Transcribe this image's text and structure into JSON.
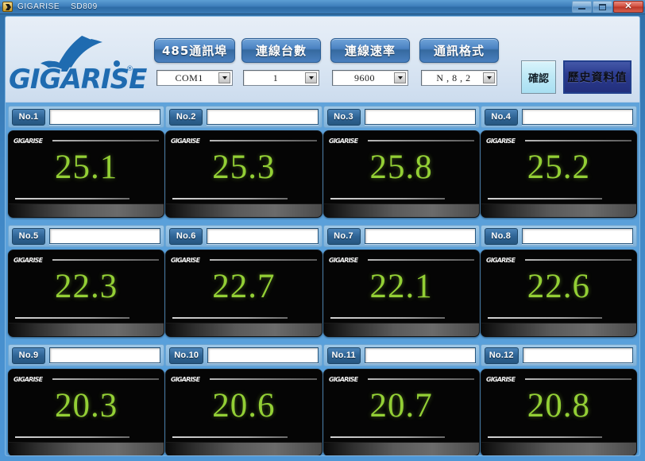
{
  "window": {
    "app_icon": "app-icon",
    "title_brand": "GIGARISE",
    "title_model": "SD809",
    "minimize_label": "",
    "maximize_label": "",
    "close_label": "✕"
  },
  "header": {
    "logo_text": "GIGARISE",
    "logo_tm": "®",
    "controls": [
      {
        "key": "port",
        "button_label": "485通訊埠",
        "value": "COM1"
      },
      {
        "key": "count",
        "button_label": "連線台數",
        "value": "1"
      },
      {
        "key": "baud",
        "button_label": "連線速率",
        "value": "9600"
      },
      {
        "key": "format",
        "button_label": "通訊格式",
        "value": "N , 8 , 2"
      }
    ],
    "confirm_label": "確認",
    "history_label": "歷史資料值"
  },
  "colors": {
    "accent_blue": "#3e7fbb",
    "panel_background": "#050505",
    "value_green": "#93cf35",
    "grid_background": "#5aa0da",
    "header_background": "#dde8f4",
    "history_button": "#2b3b8f",
    "confirm_button": "#bfe9f6"
  },
  "channels": [
    {
      "tag": "No.1",
      "name": "",
      "value": "25.1",
      "panel_logo": "GIGARISE"
    },
    {
      "tag": "No.2",
      "name": "",
      "value": "25.3",
      "panel_logo": "GIGARISE"
    },
    {
      "tag": "No.3",
      "name": "",
      "value": "25.8",
      "panel_logo": "GIGARISE"
    },
    {
      "tag": "No.4",
      "name": "",
      "value": "25.2",
      "panel_logo": "GIGARISE"
    },
    {
      "tag": "No.5",
      "name": "",
      "value": "22.3",
      "panel_logo": "GIGARISE"
    },
    {
      "tag": "No.6",
      "name": "",
      "value": "22.7",
      "panel_logo": "GIGARISE"
    },
    {
      "tag": "No.7",
      "name": "",
      "value": "22.1",
      "panel_logo": "GIGARISE"
    },
    {
      "tag": "No.8",
      "name": "",
      "value": "22.6",
      "panel_logo": "GIGARISE"
    },
    {
      "tag": "No.9",
      "name": "",
      "value": "20.3",
      "panel_logo": "GIGARISE"
    },
    {
      "tag": "No.10",
      "name": "",
      "value": "20.6",
      "panel_logo": "GIGARISE"
    },
    {
      "tag": "No.11",
      "name": "",
      "value": "20.7",
      "panel_logo": "GIGARISE"
    },
    {
      "tag": "No.12",
      "name": "",
      "value": "20.8",
      "panel_logo": "GIGARISE"
    }
  ]
}
